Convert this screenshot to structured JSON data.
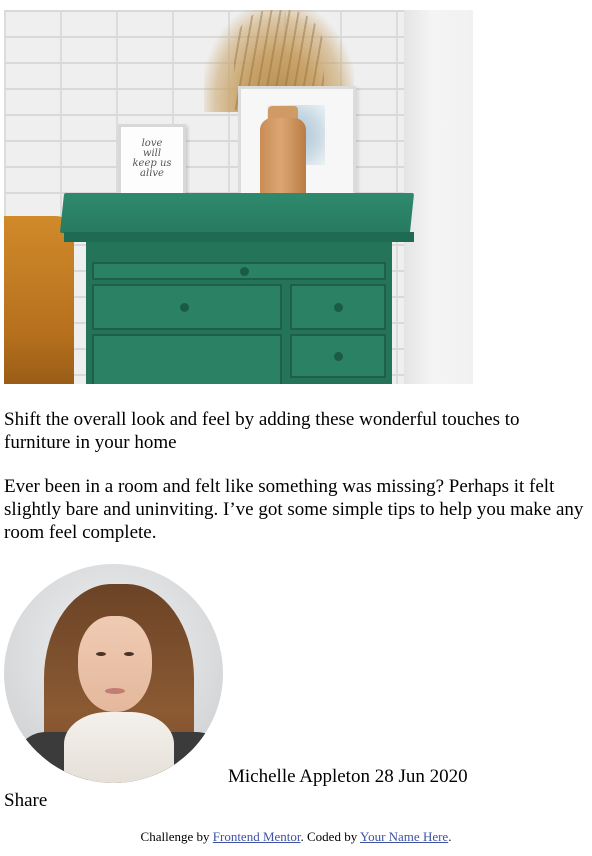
{
  "card": {
    "image_alt": "drawers",
    "frame_text": "love will keep us alive",
    "title": "Shift the overall look and feel by adding these wonderful touches to furniture in your home",
    "description": "Ever been in a room and felt like something was missing? Perhaps it felt slightly bare and uninviting. I’ve got some simple tips to help you make any room feel complete.",
    "author": {
      "name": "Michelle Appleton",
      "date": "28 Jun 2020"
    },
    "share_label": "Share"
  },
  "attribution": {
    "prefix": "Challenge by ",
    "link1": "Frontend Mentor",
    "middle": ". Coded by ",
    "link2": "Your Name Here",
    "suffix": "."
  },
  "colors": {
    "link": "#3e52a3",
    "cabinet": "#237458",
    "text": "#000000"
  }
}
